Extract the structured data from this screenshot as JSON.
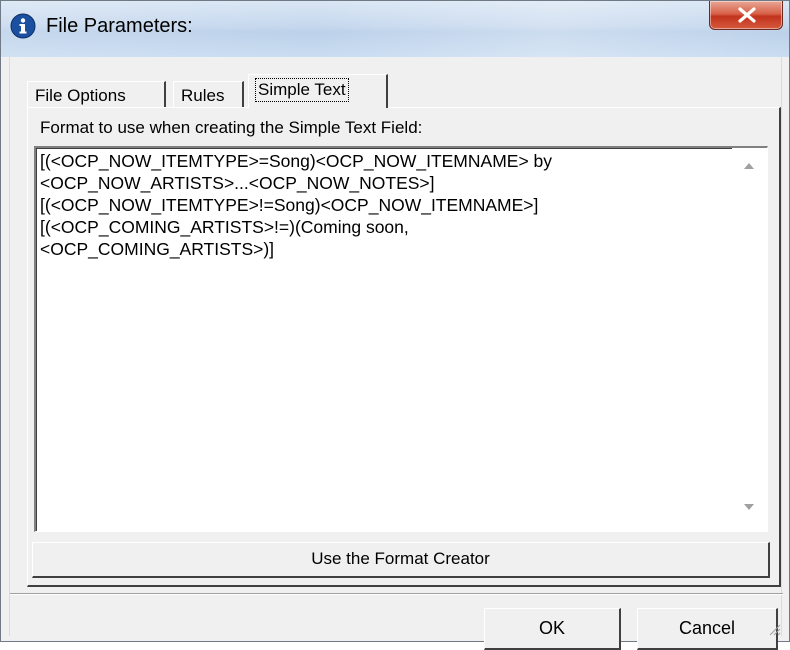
{
  "window": {
    "title": "File Parameters:",
    "title_icon": "info-icon",
    "close_icon": "close-x-icon"
  },
  "tabs": [
    {
      "label": "File Options",
      "active": false
    },
    {
      "label": "Rules",
      "active": false
    },
    {
      "label": "Simple Text",
      "active": true
    }
  ],
  "panel": {
    "format_label": "Format to use when creating the Simple Text Field:",
    "format_value": "[(<OCP_NOW_ITEMTYPE>=Song)<OCP_NOW_ITEMNAME> by\n<OCP_NOW_ARTISTS>...<OCP_NOW_NOTES>]\n[(<OCP_NOW_ITEMTYPE>!=Song)<OCP_NOW_ITEMNAME>]\n[(<OCP_COMING_ARTISTS>!=)(Coming soon,\n<OCP_COMING_ARTISTS>)]",
    "format_creator_button": "Use the Format Creator"
  },
  "buttons": {
    "ok": "OK",
    "cancel": "Cancel"
  },
  "colors": {
    "dialog_bg": "#f0f0f0",
    "close_button": "#c2331c",
    "info_icon": "#1b4fa0"
  }
}
